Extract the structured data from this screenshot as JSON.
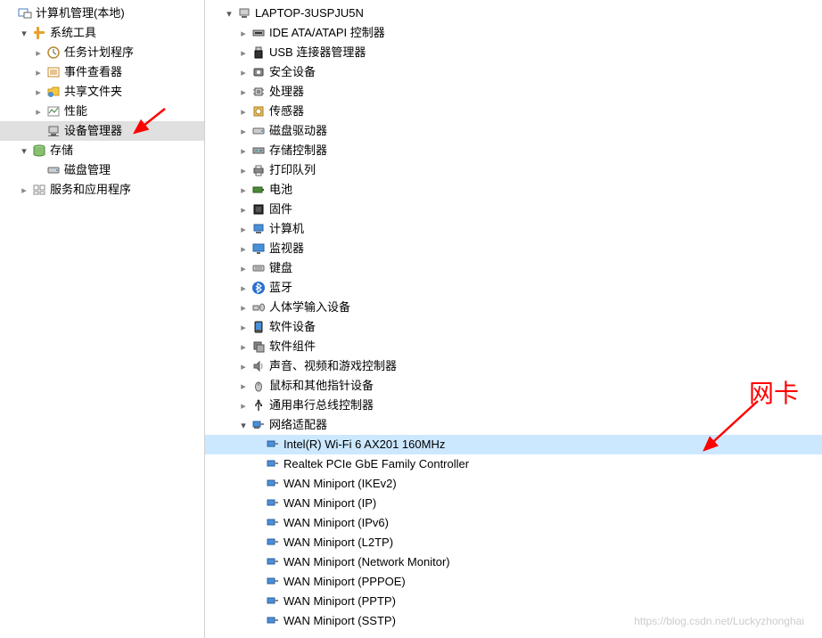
{
  "left_tree": {
    "root": {
      "label": "计算机管理(本地)"
    },
    "system_tools": {
      "label": "系统工具"
    },
    "task_scheduler": {
      "label": "任务计划程序"
    },
    "event_viewer": {
      "label": "事件查看器"
    },
    "shared_folders": {
      "label": "共享文件夹"
    },
    "performance": {
      "label": "性能"
    },
    "device_manager": {
      "label": "设备管理器"
    },
    "storage": {
      "label": "存储"
    },
    "disk_management": {
      "label": "磁盘管理"
    },
    "services_apps": {
      "label": "服务和应用程序"
    }
  },
  "right_tree": {
    "computer": {
      "label": "LAPTOP-3USPJU5N"
    },
    "ide": {
      "label": "IDE ATA/ATAPI 控制器"
    },
    "usb": {
      "label": "USB 连接器管理器"
    },
    "security": {
      "label": "安全设备"
    },
    "processor": {
      "label": "处理器"
    },
    "sensor": {
      "label": "传感器"
    },
    "diskdrive": {
      "label": "磁盘驱动器"
    },
    "storagectrl": {
      "label": "存储控制器"
    },
    "printqueue": {
      "label": "打印队列"
    },
    "battery": {
      "label": "电池"
    },
    "firmware": {
      "label": "固件"
    },
    "computers": {
      "label": "计算机"
    },
    "monitor": {
      "label": "监视器"
    },
    "keyboard": {
      "label": "键盘"
    },
    "bluetooth": {
      "label": "蓝牙"
    },
    "hid": {
      "label": "人体学输入设备"
    },
    "softdev": {
      "label": "软件设备"
    },
    "softcomp": {
      "label": "软件组件"
    },
    "sound": {
      "label": "声音、视频和游戏控制器"
    },
    "mouse": {
      "label": "鼠标和其他指针设备"
    },
    "usbctrl": {
      "label": "通用串行总线控制器"
    },
    "netadapter": {
      "label": "网络适配器"
    },
    "nic_intel": {
      "label": "Intel(R) Wi-Fi 6 AX201 160MHz"
    },
    "nic_realtek": {
      "label": "Realtek PCIe GbE Family Controller"
    },
    "nic_wan_ikev2": {
      "label": "WAN Miniport (IKEv2)"
    },
    "nic_wan_ip": {
      "label": "WAN Miniport (IP)"
    },
    "nic_wan_ipv6": {
      "label": "WAN Miniport (IPv6)"
    },
    "nic_wan_l2tp": {
      "label": "WAN Miniport (L2TP)"
    },
    "nic_wan_netmon": {
      "label": "WAN Miniport (Network Monitor)"
    },
    "nic_wan_pppoe": {
      "label": "WAN Miniport (PPPOE)"
    },
    "nic_wan_pptp": {
      "label": "WAN Miniport (PPTP)"
    },
    "nic_wan_sstp": {
      "label": "WAN Miniport (SSTP)"
    }
  },
  "annotation": {
    "label": "网卡"
  },
  "watermark": "https://blog.csdn.net/Luckyzhonghai"
}
